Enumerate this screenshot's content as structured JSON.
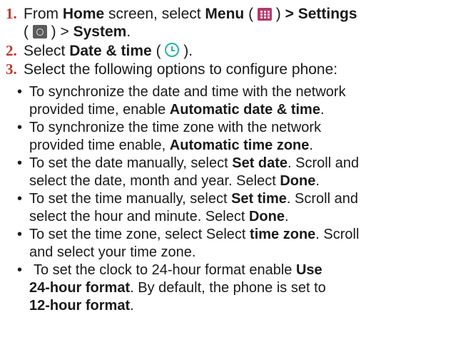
{
  "steps": [
    {
      "number": "1.",
      "line1": {
        "t1": "From ",
        "b1": "Home",
        "t2": " screen, select ",
        "b2": "Menu",
        "t3": " ( ",
        "t4": " ) ",
        "b3": "> Settings"
      },
      "line2": {
        "t1": "( ",
        "t2": " ) > ",
        "b1": "System",
        "t3": "."
      }
    },
    {
      "number": "2.",
      "line1": {
        "t1": "Select ",
        "b1": "Date & time",
        "t2": " ( ",
        "t3": " )."
      }
    },
    {
      "number": "3.",
      "line1": {
        "t1": "Select the following options to configure phone:"
      }
    }
  ],
  "bullets": [
    {
      "lines": [
        {
          "t1": "To synchronize the date and time with the network"
        },
        {
          "t1": "provided time, enable ",
          "b1": "Automatic date & time",
          "t2": "."
        }
      ]
    },
    {
      "lines": [
        {
          "t1": "To synchronize the time zone with the network"
        },
        {
          "t1": "provided time enable, ",
          "b1": "Automatic time zone",
          "t2": "."
        }
      ]
    },
    {
      "lines": [
        {
          "t1": "To set the date manually, select ",
          "b1": "Set date",
          "t2": ". Scroll and"
        },
        {
          "t1": "select the date, month and year. Select ",
          "b1": "Done",
          "t2": "."
        }
      ]
    },
    {
      "lines": [
        {
          "t1": "To set the time manually, select ",
          "b1": "Set time",
          "t2": ". Scroll and"
        },
        {
          "t1": "select the hour and minute. Select ",
          "b1": "Done",
          "t2": "."
        }
      ]
    },
    {
      "lines": [
        {
          "t1": "To set the time zone, select Select ",
          "b1": "time zone",
          "t2": ". Scroll"
        },
        {
          "t1": "and select your time zone."
        }
      ]
    },
    {
      "lines": [
        {
          "t1": "To set the clock to 24-hour format enable ",
          "b1": "Use"
        },
        {
          "b1": "24-hour format",
          "t2": ". By default, the phone is set to"
        },
        {
          "b1": "12-hour format",
          "t2": "."
        }
      ]
    }
  ],
  "icons": {
    "menu": "menu-grid-icon",
    "settings": "settings-gear-icon",
    "date_time": "clock-icon"
  },
  "colors": {
    "step_number": "#c0392b",
    "menu_icon": "#b23a6b",
    "settings_icon": "#5b5b5b",
    "clock_icon": "#27b3a8"
  }
}
